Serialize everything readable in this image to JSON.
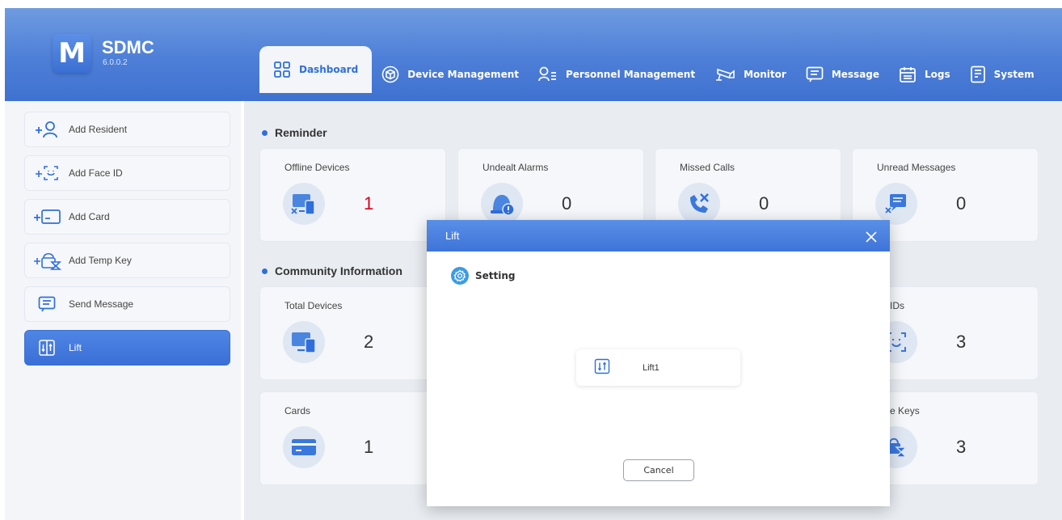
{
  "app": {
    "logo_letter": "M",
    "name": "SDMC",
    "version": "6.0.0.2"
  },
  "nav": {
    "tabs": [
      {
        "label": "Dashboard",
        "icon": "dashboard-grid-icon",
        "active": true
      },
      {
        "label": "Device Management",
        "icon": "cube-icon"
      },
      {
        "label": "Personnel Management",
        "icon": "person-list-icon"
      },
      {
        "label": "Monitor",
        "icon": "camera-icon"
      },
      {
        "label": "Message",
        "icon": "message-icon"
      },
      {
        "label": "Logs",
        "icon": "calendar-icon"
      },
      {
        "label": "System",
        "icon": "document-icon"
      }
    ]
  },
  "sidebar": {
    "items": [
      {
        "label": "Add Resident",
        "prefix": "+",
        "icon": "person-icon"
      },
      {
        "label": "Add Face ID",
        "prefix": "+",
        "icon": "face-scan-icon"
      },
      {
        "label": "Add Card",
        "prefix": "+",
        "icon": "card-icon"
      },
      {
        "label": "Add Temp Key",
        "prefix": "+",
        "icon": "temp-key-icon"
      },
      {
        "label": "Send Message",
        "prefix": "",
        "icon": "message-icon"
      },
      {
        "label": "Lift",
        "prefix": "",
        "icon": "lift-icon",
        "active": true
      }
    ]
  },
  "reminder": {
    "title": "Reminder",
    "cards": [
      {
        "label": "Offline Devices",
        "value": "1",
        "icon": "offline-device-icon",
        "alert": true
      },
      {
        "label": "Undealt Alarms",
        "value": "0",
        "icon": "alarm-icon"
      },
      {
        "label": "Missed Calls",
        "value": "0",
        "icon": "missed-call-icon"
      },
      {
        "label": "Unread Messages",
        "value": "0",
        "icon": "unread-message-icon"
      }
    ]
  },
  "community": {
    "title": "Community Information",
    "cards": [
      {
        "label": "Total Devices",
        "value": "2",
        "icon": "devices-icon"
      },
      {
        "label": "ce IDs",
        "value": "3",
        "icon": "face-id-icon"
      },
      {
        "label": "Cards",
        "value": "1",
        "icon": "card-icon"
      },
      {
        "label": "vate Keys",
        "value": "3",
        "icon": "private-key-icon"
      }
    ]
  },
  "modal": {
    "title": "Lift",
    "section": "Setting",
    "items": [
      {
        "label": "Lift1",
        "icon": "lift-icon"
      }
    ],
    "cancel_label": "Cancel"
  },
  "colors": {
    "accent": "#2f6fdc",
    "header": "#4d7fd8",
    "alert": "#d9001b"
  }
}
